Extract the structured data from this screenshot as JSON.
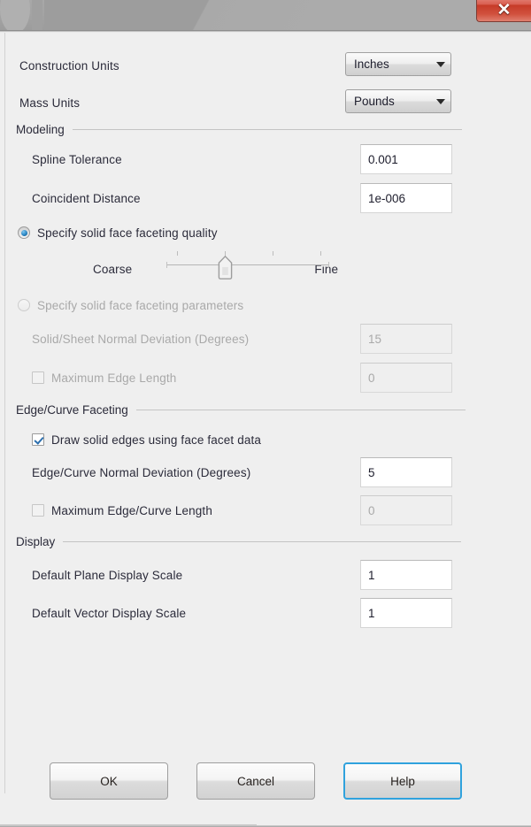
{
  "window": {
    "close_label": "✕",
    "close_icon": "close-icon"
  },
  "units": {
    "construction_label": "Construction Units",
    "construction_value": "Inches",
    "mass_label": "Mass Units",
    "mass_value": "Pounds"
  },
  "modeling": {
    "group_label": "Modeling",
    "spline_tolerance_label": "Spline Tolerance",
    "spline_tolerance_value": "0.001",
    "coincident_distance_label": "Coincident Distance",
    "coincident_distance_value": "1e-006",
    "quality_radio_label": "Specify solid face faceting quality",
    "quality_radio_selected": true,
    "slider_min_label": "Coarse",
    "slider_max_label": "Fine",
    "slider_position_percent": 33,
    "slider_tick_count": 4,
    "params_radio_label": "Specify solid face faceting parameters",
    "params_radio_selected": false,
    "normal_deviation_label": "Solid/Sheet Normal Deviation (Degrees)",
    "normal_deviation_value": "15",
    "max_edge_length_label": "Maximum Edge Length",
    "max_edge_length_checked": false,
    "max_edge_length_value": "0"
  },
  "edge_curve": {
    "group_label": "Edge/Curve Faceting",
    "draw_solid_edges_label": "Draw solid edges using face facet data",
    "draw_solid_edges_checked": true,
    "normal_deviation_label": "Edge/Curve Normal Deviation (Degrees)",
    "normal_deviation_value": "5",
    "max_length_label": "Maximum Edge/Curve Length",
    "max_length_checked": false,
    "max_length_value": "0"
  },
  "display": {
    "group_label": "Display",
    "plane_scale_label": "Default Plane Display Scale",
    "plane_scale_value": "1",
    "vector_scale_label": "Default Vector Display Scale",
    "vector_scale_value": "1"
  },
  "footer": {
    "ok_label": "OK",
    "cancel_label": "Cancel",
    "help_label": "Help"
  },
  "colors": {
    "dialog_background": "#efefef",
    "titlebar": "#a8a8a8",
    "close_button": "#c63b28",
    "accent_focus": "#30a2dd",
    "radio_selected": "#2a86c4",
    "checkbox_check": "#2c6fae",
    "text": "#2b2b3a",
    "text_disabled": "#a9a9a9"
  }
}
